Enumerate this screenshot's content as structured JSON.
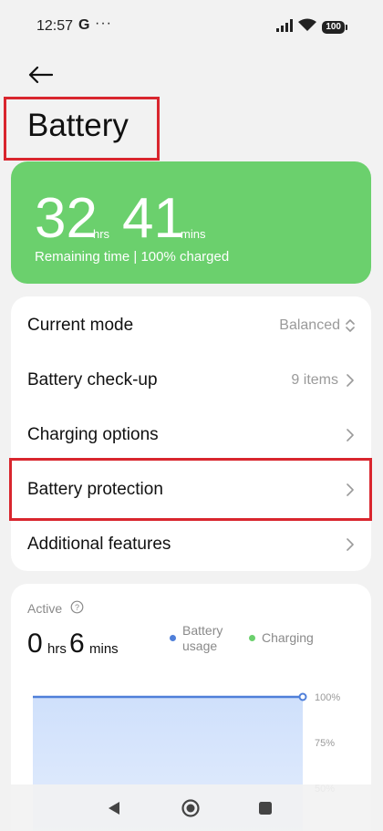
{
  "status_bar": {
    "time": "12:57",
    "g_label": "G",
    "dots": "···",
    "battery_level": "100"
  },
  "header": {
    "title": "Battery"
  },
  "remaining": {
    "hours": "32",
    "hours_unit": "hrs",
    "minutes": "41",
    "minutes_unit": "mins",
    "subtitle": "Remaining time | 100% charged",
    "card_color": "#6bd06d"
  },
  "settings": {
    "rows": [
      {
        "label": "Current mode",
        "value": "Balanced",
        "icon": "up-down-chevron-icon"
      },
      {
        "label": "Battery check-up",
        "value": "9 items",
        "icon": "chevron-right-icon"
      },
      {
        "label": "Charging options",
        "value": "",
        "icon": "chevron-right-icon"
      },
      {
        "label": "Battery protection",
        "value": "",
        "icon": "chevron-right-icon"
      },
      {
        "label": "Additional features",
        "value": "",
        "icon": "chevron-right-icon"
      }
    ]
  },
  "activity": {
    "label": "Active",
    "hours": "0",
    "hours_unit": "hrs",
    "minutes": "6",
    "minutes_unit": "mins",
    "legend": [
      {
        "name": "Battery usage",
        "line1": "Battery",
        "line2": "usage",
        "color": "#4f7fd9"
      },
      {
        "name": "Charging",
        "line1": "Charging",
        "line2": "",
        "color": "#6bd06d"
      }
    ]
  },
  "chart_data": {
    "type": "area",
    "y_tick_labels": [
      "100%",
      "75%",
      "50%"
    ],
    "series": [
      {
        "name": "Battery usage",
        "values": [
          100,
          100
        ]
      }
    ],
    "ylim": [
      50,
      100
    ],
    "grid": true
  },
  "nav": {
    "icons": [
      "back-triangle-icon",
      "home-circle-icon",
      "recents-square-icon"
    ]
  },
  "colors": {
    "highlight_red": "#d9262e",
    "chart_blue": "#4f7fd9"
  }
}
